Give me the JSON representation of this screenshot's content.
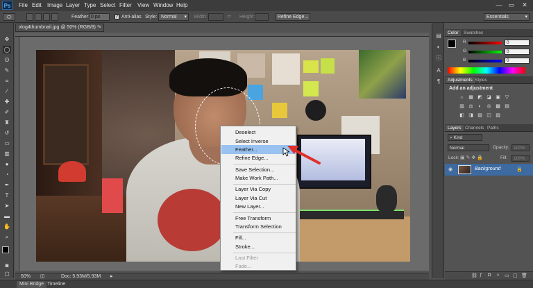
{
  "app": {
    "logo": "Ps"
  },
  "menubar": {
    "items": [
      "File",
      "Edit",
      "Image",
      "Layer",
      "Type",
      "Select",
      "Filter",
      "View",
      "Window",
      "Help"
    ]
  },
  "window_controls": [
    "—",
    "▭",
    "✕"
  ],
  "options_bar": {
    "feather_label": "Feather:",
    "feather_value": "0 px",
    "antialias_label": "Anti-alias",
    "style_label": "Style:",
    "style_value": "Normal",
    "width_label": "Width:",
    "height_label": "Height:",
    "refine_edge_button": "Refine Edge...",
    "workspace_value": "Essentials"
  },
  "document": {
    "tab_title": "vlog4thumbnail.jpg @ 50% (RGB/8) *",
    "tab_close": "×",
    "zoom": "50%",
    "doc_size": "Doc: 5.93M/5.93M"
  },
  "context_menu": {
    "items": [
      {
        "label": "Deselect",
        "enabled": true
      },
      {
        "label": "Select Inverse",
        "enabled": true
      },
      {
        "label": "Feather...",
        "enabled": true,
        "highlighted": true
      },
      {
        "label": "Refine Edge...",
        "enabled": true
      },
      {
        "separator": true
      },
      {
        "label": "Save Selection...",
        "enabled": true
      },
      {
        "label": "Make Work Path...",
        "enabled": true
      },
      {
        "separator": true
      },
      {
        "label": "Layer Via Copy",
        "enabled": true
      },
      {
        "label": "Layer Via Cut",
        "enabled": true
      },
      {
        "label": "New Layer...",
        "enabled": true
      },
      {
        "separator": true
      },
      {
        "label": "Free Transform",
        "enabled": true
      },
      {
        "label": "Transform Selection",
        "enabled": true
      },
      {
        "separator": true
      },
      {
        "label": "Fill...",
        "enabled": true
      },
      {
        "label": "Stroke...",
        "enabled": true
      },
      {
        "separator": true
      },
      {
        "label": "Last Filter",
        "enabled": false
      },
      {
        "label": "Fade...",
        "enabled": false
      }
    ]
  },
  "color_panel": {
    "tabs": [
      "Color",
      "Swatches"
    ],
    "channels": [
      {
        "label": "R",
        "value": "0",
        "color": "#cc2222"
      },
      {
        "label": "G",
        "value": "0",
        "color": "#22aa22"
      },
      {
        "label": "B",
        "value": "0",
        "color": "#2244cc"
      }
    ]
  },
  "adjustments_panel": {
    "tabs": [
      "Adjustments",
      "Styles"
    ],
    "title": "Add an adjustment",
    "row1_icons": [
      "☼",
      "▦",
      "◩",
      "◪",
      "▣",
      "▽"
    ],
    "row2_icons": [
      "▥",
      "⚖",
      "◐",
      "◎",
      "▩",
      "▤"
    ],
    "row3_icons": [
      "◧",
      "◨",
      "▧",
      "◫",
      "▨"
    ]
  },
  "layers_panel": {
    "tabs": [
      "Layers",
      "Channels",
      "Paths"
    ],
    "kind_label": "Kind",
    "blend_mode": "Normal",
    "opacity_label": "Opacity:",
    "opacity_value": "100%",
    "lock_label": "Lock:",
    "fill_label": "Fill:",
    "fill_value": "100%",
    "layer_name": "Background"
  },
  "bottom_tabs": [
    "Mini Bridge",
    "Timeline"
  ],
  "colors": {
    "highlight": "#99c2f0",
    "arrow": "#e0302a"
  }
}
